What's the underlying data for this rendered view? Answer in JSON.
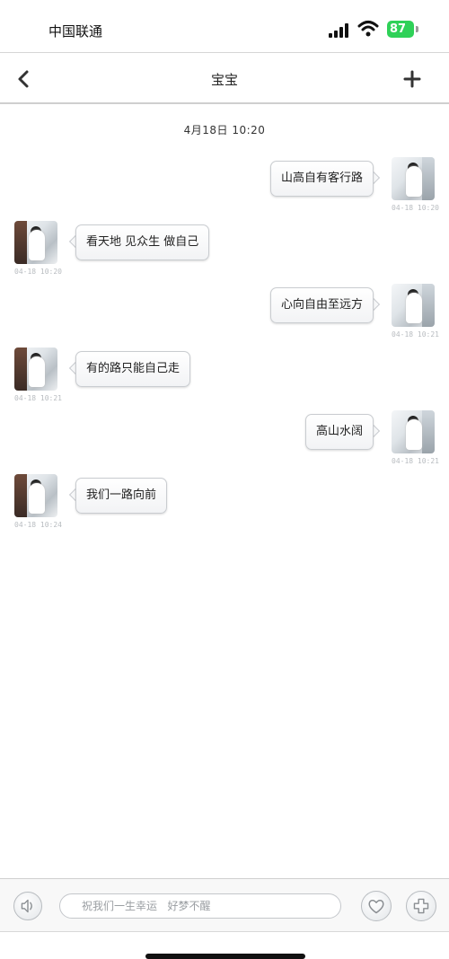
{
  "status_bar": {
    "carrier": "中国联通",
    "battery": "87"
  },
  "nav": {
    "title": "宝宝"
  },
  "chat": {
    "date_divider": "4月18日 10:20",
    "messages": [
      {
        "side": "right",
        "text": "山高自有客行路",
        "time": "04-18 10:20"
      },
      {
        "side": "left",
        "text": "看天地  见众生  做自己",
        "time": "04-18 10:20"
      },
      {
        "side": "right",
        "text": "心向自由至远方",
        "time": "04-18 10:21"
      },
      {
        "side": "left",
        "text": "有的路只能自己走",
        "time": "04-18 10:21"
      },
      {
        "side": "right",
        "text": "高山水阔",
        "time": "04-18 10:21"
      },
      {
        "side": "left",
        "text": "我们一路向前",
        "time": "04-18 10:24"
      }
    ]
  },
  "input_bar": {
    "placeholder": "祝我们一生幸运   好梦不醒"
  },
  "colors": {
    "battery_green": "#2fd158",
    "bubble_border": "#c9ccd0"
  },
  "icons": {
    "back": "chevron-left-icon",
    "add": "plus-icon",
    "voice": "speaker-icon",
    "emoji": "heart-icon",
    "more": "plus-circle-icon"
  }
}
